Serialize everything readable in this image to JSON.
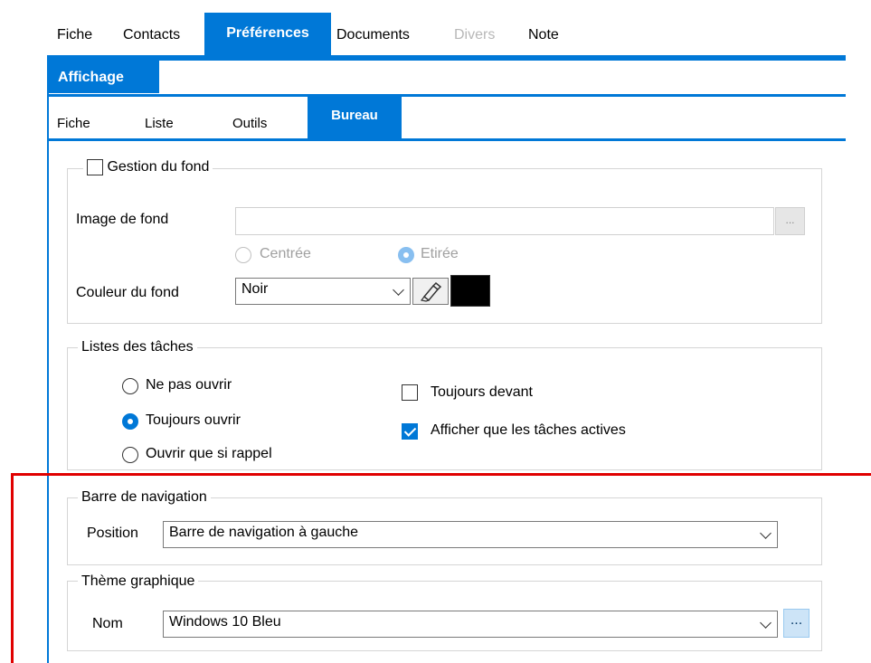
{
  "top_tabs": {
    "fiche": "Fiche",
    "contacts": "Contacts",
    "preferences": "Préférences",
    "documents": "Documents",
    "divers": "Divers",
    "note": "Note"
  },
  "section_header": "Affichage",
  "sub_tabs": {
    "fiche": "Fiche",
    "liste": "Liste",
    "outils": "Outils",
    "bureau": "Bureau"
  },
  "background_group": {
    "gestion_label": "Gestion du fond",
    "gestion_checked": false,
    "image_label": "Image de fond",
    "image_value": "",
    "image_browse": "...",
    "centree_label": "Centrée",
    "etiree_label": "Etirée",
    "etiree_checked": true,
    "couleur_label": "Couleur du fond",
    "couleur_value": "Noir",
    "couleur_swatch": "#000000"
  },
  "tasks_group": {
    "legend": "Listes des tâches",
    "ne_pas_ouvrir": "Ne pas ouvrir",
    "toujours_ouvrir": "Toujours ouvrir",
    "ouvrir_si_rappel": "Ouvrir que si rappel",
    "selected": "Toujours ouvrir",
    "toujours_devant": "Toujours devant",
    "toujours_devant_checked": false,
    "afficher_actives": "Afficher que les tâches actives",
    "afficher_actives_checked": true
  },
  "nav_group": {
    "legend": "Barre de navigation",
    "position_label": "Position",
    "position_value": "Barre de navigation à gauche"
  },
  "theme_group": {
    "legend": "Thème graphique",
    "nom_label": "Nom",
    "nom_value": "Windows 10 Bleu",
    "more_button": "..."
  },
  "colors": {
    "accent": "#0078d7",
    "highlight": "#e00000"
  }
}
